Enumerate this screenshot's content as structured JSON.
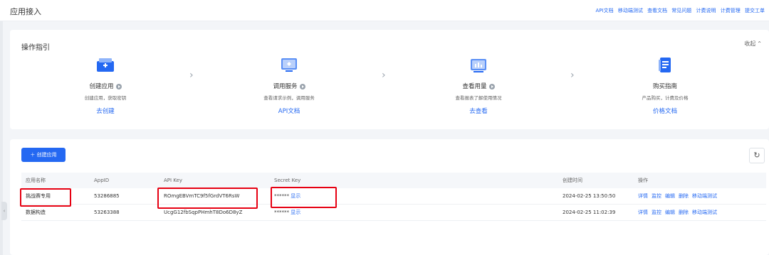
{
  "header": {
    "title": "应用接入",
    "links": [
      "API文档",
      "移动端测试",
      "查看文档",
      "常见问题",
      "计费说明",
      "计费管理",
      "提交工单"
    ]
  },
  "guide": {
    "title": "操作指引",
    "collapse_label": "收起",
    "steps": [
      {
        "icon": "create-app-icon",
        "name": "创建应用",
        "desc": "创建应用，获取密钥",
        "link": "去创建"
      },
      {
        "icon": "call-service-icon",
        "name": "调用服务",
        "desc": "查看请求示例，调用服务",
        "link": "API文档"
      },
      {
        "icon": "usage-chart-icon",
        "name": "查看用量",
        "desc": "查看报表了解使用情况",
        "link": "去查看"
      },
      {
        "icon": "purchase-guide-icon",
        "name": "购买指南",
        "desc": "产品购买，计费及价格",
        "link": "价格文档"
      }
    ]
  },
  "list": {
    "create_button": "创建应用",
    "columns": [
      "应用名称",
      "AppID",
      "API Key",
      "Secret Key",
      "创建时间",
      "操作"
    ],
    "rows": [
      {
        "name": "挑战赛专用",
        "appid": "53286885",
        "api_key": "ROmgEBVmTC9f5fGrdVT6RsW",
        "secret": "******",
        "show": "显示",
        "created": "2024-02-25 13:50:50",
        "ops": [
          "详情",
          "监控",
          "编辑",
          "删除",
          "移动端测试"
        ]
      },
      {
        "name": "数据构造",
        "appid": "53263388",
        "api_key": "UcgG12fbSqpPHmhT8Do6D8yZ",
        "secret": "******",
        "show": "显示",
        "created": "2024-02-25 11:02:39",
        "ops": [
          "详情",
          "监控",
          "编辑",
          "删除",
          "移动端测试"
        ]
      }
    ]
  },
  "colors": {
    "accent": "#2468f2",
    "highlight": "#e60012"
  }
}
